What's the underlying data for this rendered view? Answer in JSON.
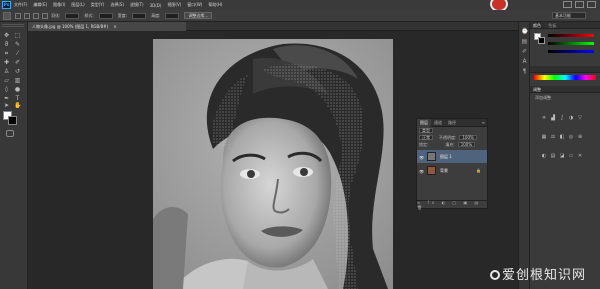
{
  "menubar": {
    "logo": "Ps",
    "items": [
      "文件(F)",
      "编辑(E)",
      "图像(I)",
      "图层(L)",
      "类型(Y)",
      "选择(S)",
      "滤镜(T)",
      "3D(D)",
      "视图(V)",
      "窗口(W)",
      "帮助(H)"
    ]
  },
  "options": {
    "feather_label": "羽化:",
    "style_label": "样式:",
    "width_label": "宽度:",
    "height_label": "高度:",
    "refine_button": "调整边缘...",
    "workspace": "基本功能"
  },
  "document": {
    "tab_title": "人物头像.jpg @ 100% (图层 1, RGB/8#)",
    "tab_close": "×"
  },
  "layers_panel": {
    "tabs": [
      "图层",
      "通道",
      "路径"
    ],
    "kind_label": "类型",
    "blend_mode": "正常",
    "opacity_label": "不透明度:",
    "opacity": "100%",
    "lock_label": "锁定:",
    "fill_label": "填充:",
    "fill": "100%",
    "layers": [
      {
        "name": "图层 1",
        "selected": true
      },
      {
        "name": "背景",
        "selected": false,
        "locked": true
      }
    ],
    "bottom_icons": "∞ fx ◐ ▢ ▣ ▤ 🗑"
  },
  "right_panel": {
    "color_tab": "颜色",
    "swatch_tab": "色板",
    "adjust_tab": "调整",
    "adjust_subtitle": "添加调整"
  },
  "colors": {
    "foreground": "#ffffff",
    "background": "#000000",
    "selected_layer": "#50637c"
  },
  "watermark": {
    "text": "爱创根知识网"
  }
}
